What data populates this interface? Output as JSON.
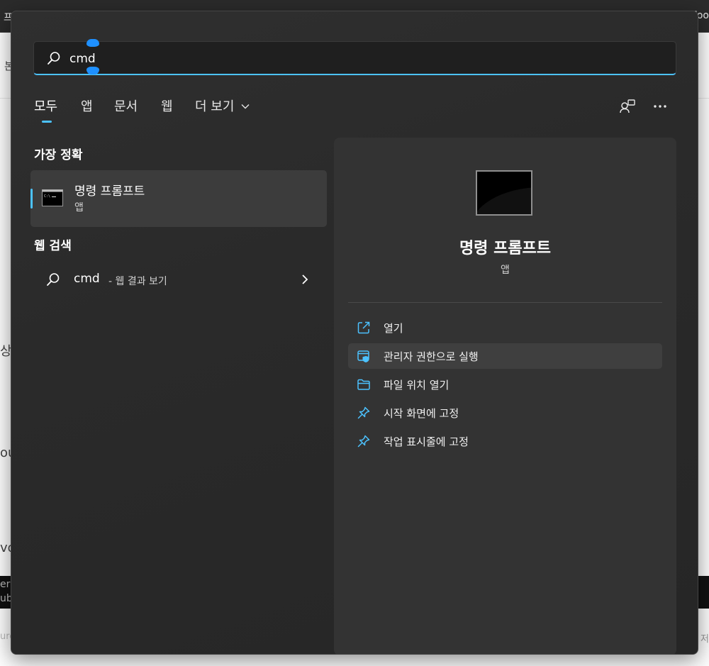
{
  "background": {
    "tab_left": "프",
    "tab_right": "Foo",
    "fragment_1": "본",
    "fragment_2": "상(",
    "fragment_3": "ou",
    "fragment_4": "vo",
    "dark_line_1": "er",
    "dark_line_2": "ub",
    "bottom_left": "urc",
    "bottom_right": "저"
  },
  "search": {
    "value": "cmd",
    "placeholder": ""
  },
  "tabs": [
    {
      "label": "모두",
      "active": true
    },
    {
      "label": "앱",
      "active": false
    },
    {
      "label": "문서",
      "active": false
    },
    {
      "label": "웹",
      "active": false
    },
    {
      "label": "더 보기",
      "active": false
    }
  ],
  "icons": {
    "search": "search-icon",
    "more_chevron": "chevron-down-icon",
    "account": "account-switch-icon",
    "more_options": "ellipsis-icon",
    "command_prompt": "command-prompt-icon",
    "chevron_right": "chevron-right-icon"
  },
  "results": {
    "best_match_title": "가장 정확",
    "best_match": {
      "name": "명령 프롬프트",
      "type": "앱"
    },
    "web_title": "웹 검색",
    "web_result": {
      "query": "cmd",
      "suffix": "- 웹 결과 보기"
    }
  },
  "preview": {
    "app_name": "명령 프롬프트",
    "app_type": "앱",
    "actions": [
      {
        "label": "열기",
        "icon": "open-external-icon"
      },
      {
        "label": "관리자 권한으로 실행",
        "icon": "run-as-admin-shield-icon"
      },
      {
        "label": "파일 위치 열기",
        "icon": "folder-icon"
      },
      {
        "label": "시작 화면에 고정",
        "icon": "pin-icon"
      },
      {
        "label": "작업 표시줄에 고정",
        "icon": "pin-taskbar-icon"
      }
    ]
  },
  "colors": {
    "accent": "#4cc2ff",
    "panel": "#2c2c2c",
    "preview_pane": "#333333",
    "selected_item": "#3c3c3c"
  }
}
